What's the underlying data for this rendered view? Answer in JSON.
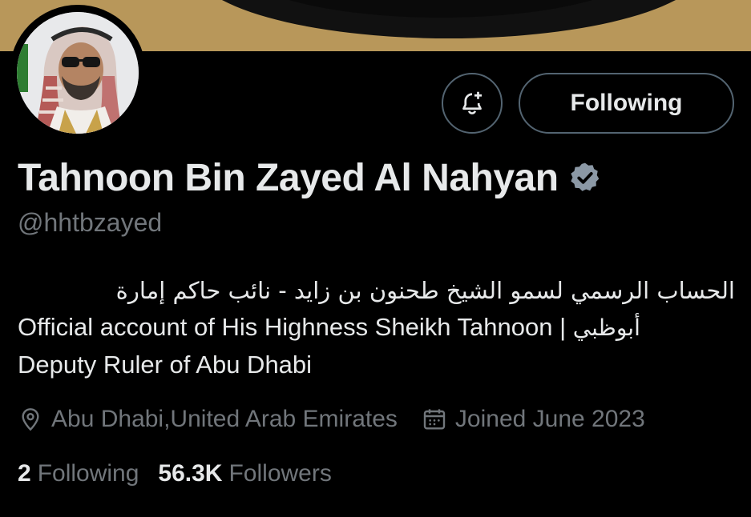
{
  "profile": {
    "name": "Tahnoon Bin Zayed Al Nahyan",
    "handle": "@hhtbzayed",
    "verified_icon": "verified-badge-icon",
    "bio": {
      "arabic_line": "الحساب الرسمي لسمو الشيخ طحنون بن زايد - نائب حاكم إمارة",
      "english_line_1": "Official account of His Highness Sheikh Tahnoon | ",
      "english_line_1_arabic_tail": "أبوظبي",
      "english_line_2": "Deputy Ruler of Abu Dhabi"
    },
    "location": "Abu Dhabi,United Arab Emirates",
    "joined": "Joined June 2023",
    "stats": {
      "following_count": "2",
      "following_label": "Following",
      "followers_count": "56.3K",
      "followers_label": "Followers"
    }
  },
  "actions": {
    "notify_icon": "bell-plus-icon",
    "follow_label": "Following"
  },
  "icons": {
    "location": "location-pin-icon",
    "calendar": "calendar-icon"
  },
  "colors": {
    "background": "#000000",
    "primary_text": "#e7e9ea",
    "secondary_text": "#71767b",
    "border": "#536471",
    "banner_gold": "#b8975a",
    "verified": "#8b98a5"
  }
}
